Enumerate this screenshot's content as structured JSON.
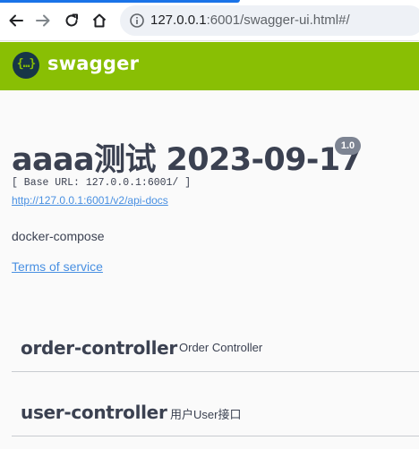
{
  "browser": {
    "url_host": "127.0.0.1",
    "url_rest": ":6001/swagger-ui.html#/"
  },
  "topbar": {
    "logo_glyph": "{…}",
    "logo_text": "swagger",
    "color": "#89bf04"
  },
  "info": {
    "title": "aaaa测试 2023-09-17",
    "version": "1.0",
    "base_url": "[ Base URL: 127.0.0.1:6001/ ]",
    "api_docs_link": "http://127.0.0.1:6001/v2/api-docs",
    "description": "docker-compose",
    "terms_of_service": "Terms of service"
  },
  "tags": [
    {
      "name": "order-controller",
      "description": "Order Controller"
    },
    {
      "name": "user-controller",
      "description": "用户User接口"
    }
  ]
}
